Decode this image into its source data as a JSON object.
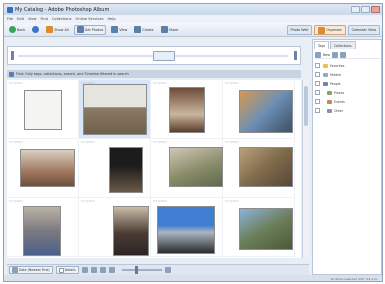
{
  "window": {
    "title": "My Catalog - Adobe Photoshop Album"
  },
  "menu": [
    "File",
    "Edit",
    "View",
    "Find",
    "Collections",
    "Online Services",
    "Help"
  ],
  "toolbar": {
    "back": "Back",
    "show_all": "Show All",
    "get_photos": "Get Photos",
    "view": "View",
    "create": "Create",
    "share": "Share"
  },
  "tabs": {
    "photo_well": "Photo Well",
    "organize": "Organize",
    "calendar": "Calendar View"
  },
  "view_header": "Find: Only tags, collections, search, and Timeline filtered in search",
  "photo_captions": [
    "5/7/2003",
    "5/7/2003",
    "5/7/2003",
    "5/7/2003",
    "5/7/2003",
    "5/7/2003",
    "5/7/2003",
    "5/7/2003",
    "5/7/2003",
    "5/7/2003",
    "5/7/2003",
    "5/7/2003"
  ],
  "bottom": {
    "sort": "Date (Newest First)",
    "details": "Details"
  },
  "status": "10 items selected 4/07 .04 a.m.",
  "panel": {
    "tabs": [
      "Tags",
      "Collections"
    ],
    "new_label": "New",
    "tags": [
      "Favorites",
      "Hidden",
      "People",
      "Places",
      "Events",
      "Other"
    ]
  }
}
